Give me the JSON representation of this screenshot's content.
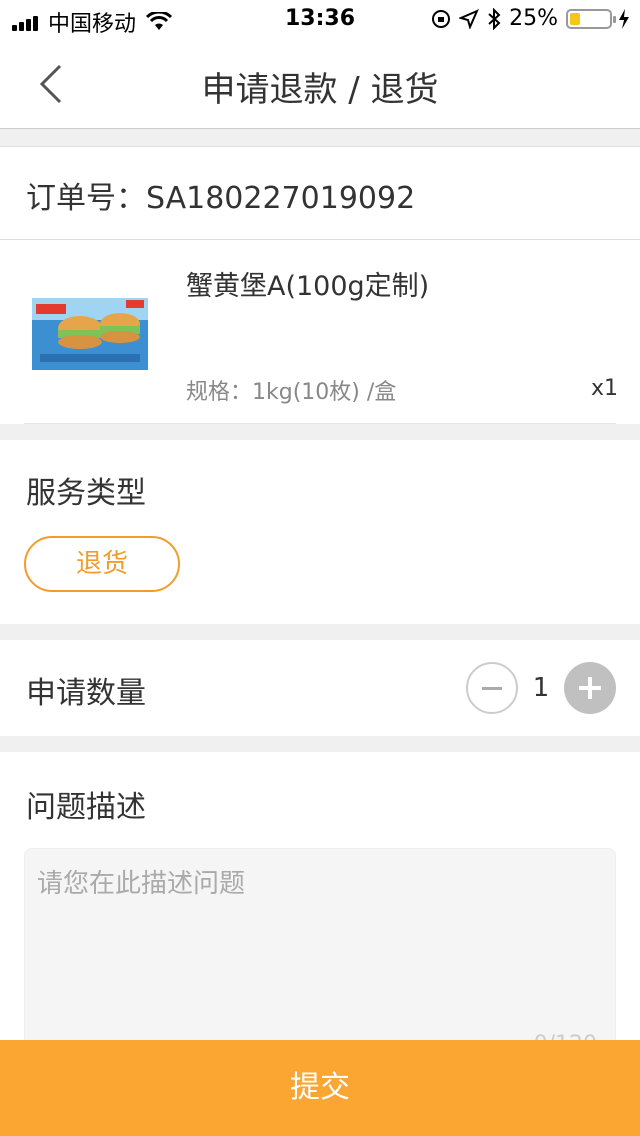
{
  "status_bar": {
    "carrier": "中国移动",
    "time": "13:36",
    "battery": "25%",
    "battery_level": 25
  },
  "navbar": {
    "title": "申请退款 / 退货"
  },
  "order": {
    "label": "订单号：",
    "number": "SA180227019092"
  },
  "product": {
    "name": "蟹黄堡A(100g定制)",
    "spec": "规格：1kg(10枚) /盒",
    "quantity": "x1",
    "image_icon": "burger-box-image"
  },
  "service": {
    "title": "服务类型",
    "option": "退货"
  },
  "quantity": {
    "title": "申请数量",
    "value": "1"
  },
  "description": {
    "title": "问题描述",
    "placeholder": "请您在此描述问题",
    "counter": "0/120"
  },
  "submit": {
    "label": "提交"
  },
  "colors": {
    "accent": "#f39c2a",
    "submit_bg": "#fba532"
  }
}
